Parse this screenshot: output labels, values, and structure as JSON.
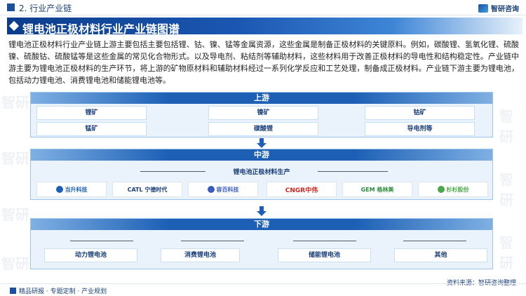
{
  "header": {
    "section": "2. 行业产业链",
    "brand": "智研咨询"
  },
  "title": "锂电池正极材料行业产业链图谱",
  "intro": "锂电池正极材料行业产业链上游主要包括主要包括锂、钴、镍、锰等金属资源，这些金属是制备正极材料的关键原料。例如，碳酸锂、氢氧化锂、硫酸镍、硫酸钴、硫酸锰等是这些金属的常见化合物形式。以及导电剂、粘结剂等辅助材料，这些材料用于改善正极材料的导电性和结构稳定性。产业链中游主要为锂电池正极材料的生产环节，将上游的矿物原材料和辅助材料经过一系列化学反应和工艺处理，制备成正极材料。产业链下游主要为锂电池，包括动力锂电池、消费锂电池和储能锂电池等。",
  "upstream": {
    "title": "上游",
    "items": [
      "锂矿",
      "镍矿",
      "钴矿",
      "锰矿",
      "碳酸锂",
      "导电剂等"
    ]
  },
  "midstream": {
    "title": "中游",
    "label": "锂电池正极材料生产",
    "companies": [
      "当升科技",
      "CATL 宁德时代",
      "容百科技",
      "CNGR中伟",
      "GEM 格林美",
      "杉杉股份"
    ]
  },
  "downstream": {
    "title": "下游",
    "items": [
      "动力锂电池",
      "消费锂电池",
      "储能锂电池",
      "其他"
    ]
  },
  "footer": {
    "left": "精品研报 · 专题定制 · 产业规划",
    "source": "资料来源：智研咨询整理"
  },
  "watermark": "智研"
}
